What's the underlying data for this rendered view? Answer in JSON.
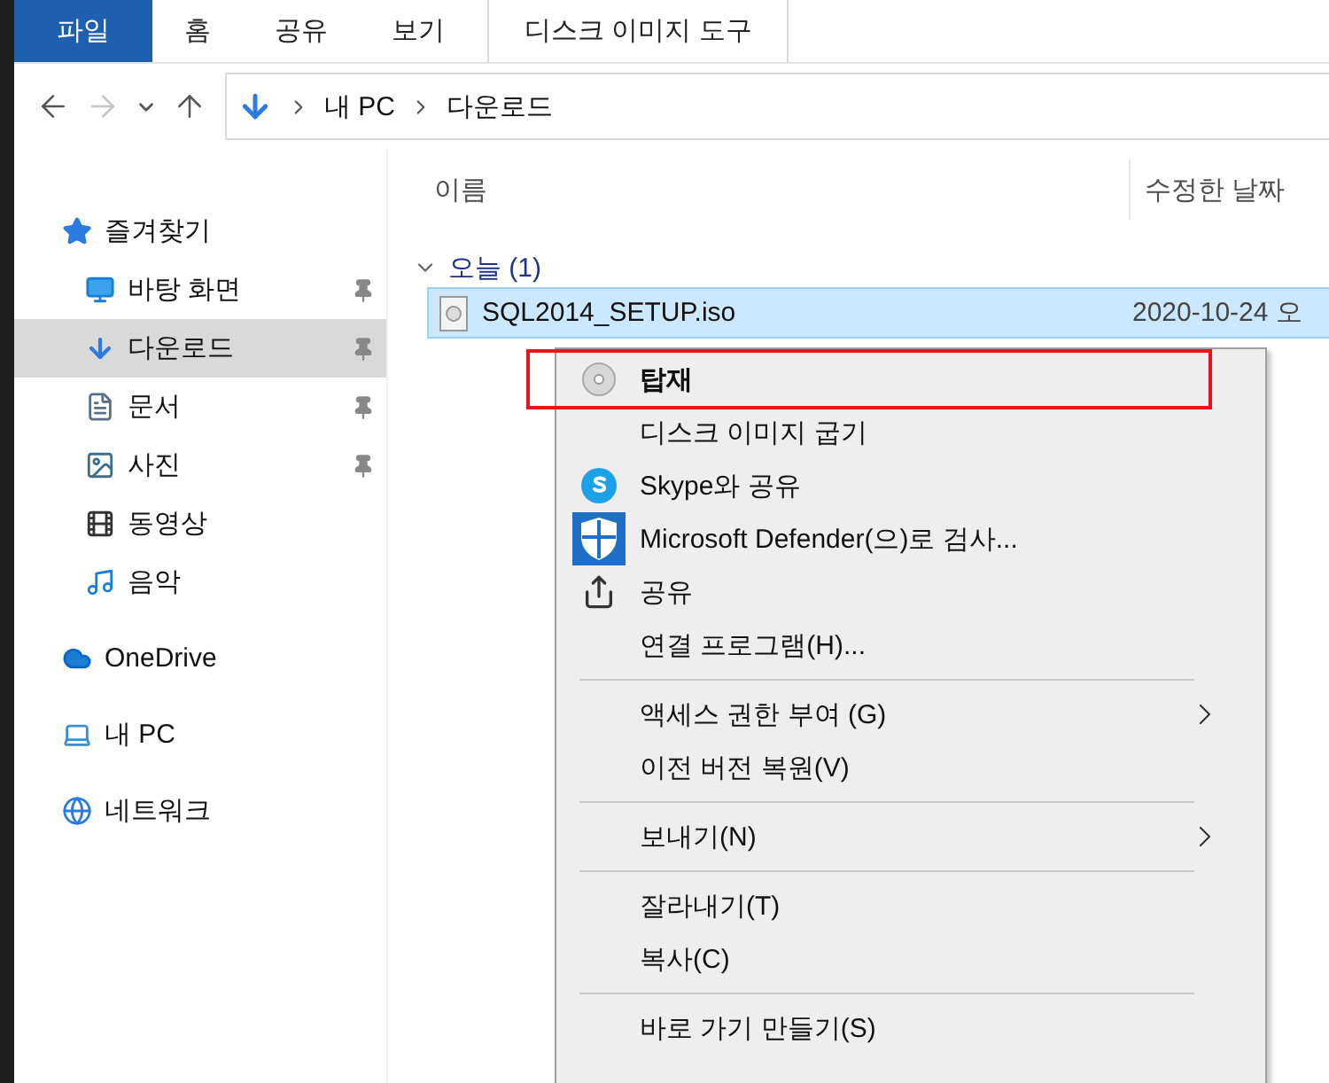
{
  "ribbon_tabs": [
    {
      "label": "파일",
      "selected": true,
      "kind": "file"
    },
    {
      "label": "홈",
      "selected": false,
      "kind": "normal"
    },
    {
      "label": "공유",
      "selected": false,
      "kind": "normal"
    },
    {
      "label": "보기",
      "selected": false,
      "kind": "normal"
    },
    {
      "label": "디스크 이미지 도구",
      "selected": false,
      "kind": "context"
    }
  ],
  "nav_buttons": [
    {
      "kind": "back",
      "disabled": false
    },
    {
      "kind": "forward",
      "disabled": true
    },
    {
      "kind": "recent",
      "disabled": false
    },
    {
      "kind": "up",
      "disabled": false
    }
  ],
  "address": {
    "path": [
      "내 PC",
      "다운로드"
    ]
  },
  "sidebar": [
    {
      "label": "즐겨찾기",
      "kind": "star",
      "selected": false,
      "children": [
        {
          "label": "바탕 화면",
          "kind": "desktop",
          "pinned": true,
          "selected": false
        },
        {
          "label": "다운로드",
          "kind": "download",
          "pinned": true,
          "selected": true
        },
        {
          "label": "문서",
          "kind": "document",
          "pinned": true,
          "selected": false
        },
        {
          "label": "사진",
          "kind": "picture",
          "pinned": true,
          "selected": false
        },
        {
          "label": "동영상",
          "kind": "video",
          "pinned": false,
          "selected": false
        },
        {
          "label": "음악",
          "kind": "music",
          "pinned": false,
          "selected": false
        }
      ]
    },
    {
      "label": "OneDrive",
      "kind": "cloud",
      "selected": false
    },
    {
      "label": "내 PC",
      "kind": "pc",
      "selected": false
    },
    {
      "label": "네트워크",
      "kind": "network",
      "selected": false
    }
  ],
  "columns": [
    "이름",
    "수정한 날짜"
  ],
  "group": {
    "label": "오늘 (1)",
    "expanded": true
  },
  "files": [
    {
      "name": "SQL2014_SETUP.iso",
      "date": "2020-10-24 오",
      "selected": true
    }
  ],
  "context_menu": [
    {
      "kind": "disc",
      "label": "탑재",
      "highlighted": true,
      "submenu": false
    },
    {
      "kind": "item",
      "label": "디스크 이미지 굽기",
      "highlighted": false,
      "submenu": false
    },
    {
      "kind": "skype",
      "label": "Skype와 공유",
      "highlighted": false,
      "submenu": false
    },
    {
      "kind": "shield",
      "label": "Microsoft Defender(으)로 검사...",
      "highlighted": false,
      "submenu": false
    },
    {
      "kind": "share",
      "label": "공유",
      "highlighted": false,
      "submenu": false
    },
    {
      "kind": "item",
      "label": "연결 프로그램(H)...",
      "highlighted": false,
      "submenu": false
    },
    {
      "kind": "separator"
    },
    {
      "kind": "item",
      "label": "액세스 권한 부여 (G)",
      "highlighted": false,
      "submenu": true
    },
    {
      "kind": "item",
      "label": "이전 버전 복원(V)",
      "highlighted": false,
      "submenu": false
    },
    {
      "kind": "separator"
    },
    {
      "kind": "item",
      "label": "보내기(N)",
      "highlighted": false,
      "submenu": true
    },
    {
      "kind": "separator"
    },
    {
      "kind": "item",
      "label": "잘라내기(T)",
      "highlighted": false,
      "submenu": false
    },
    {
      "kind": "item",
      "label": "복사(C)",
      "highlighted": false,
      "submenu": false
    },
    {
      "kind": "separator"
    },
    {
      "kind": "item",
      "label": "바로 가기 만들기(S)",
      "highlighted": false,
      "submenu": false
    }
  ]
}
